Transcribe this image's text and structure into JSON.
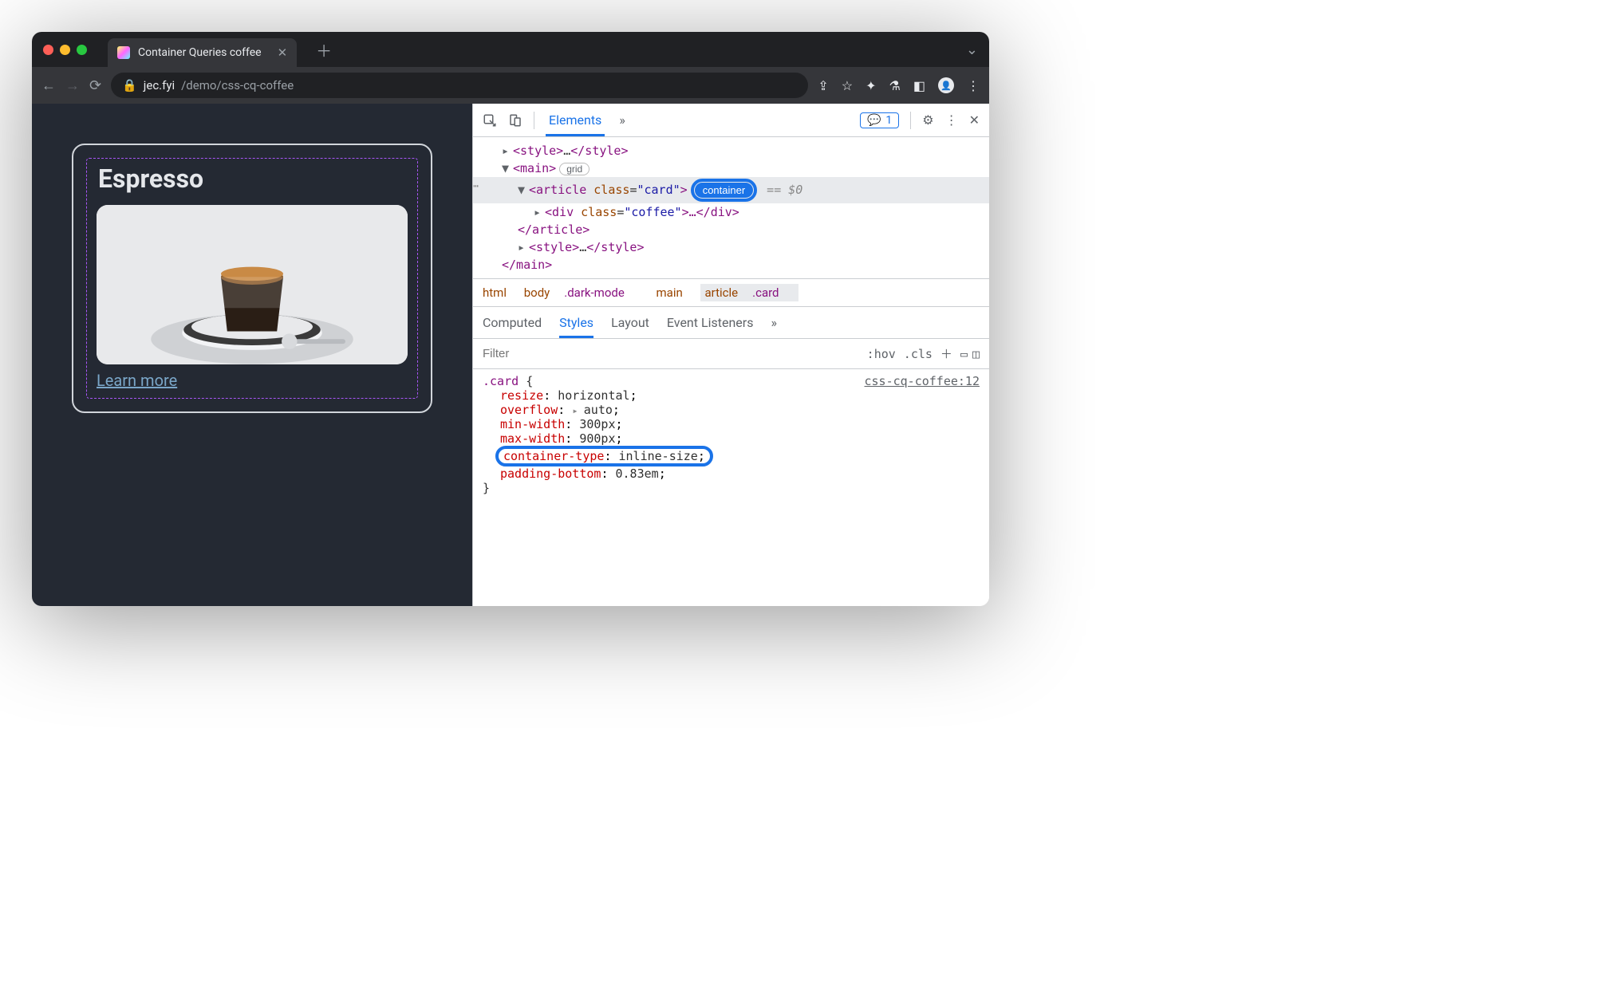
{
  "tab": {
    "title": "Container Queries coffee"
  },
  "url": {
    "host": "jec.fyi",
    "path": "/demo/css-cq-coffee"
  },
  "page": {
    "heading": "Espresso",
    "link": "Learn more"
  },
  "devtools": {
    "topTabs": {
      "elements": "Elements",
      "more": "»",
      "msgCount": "1"
    },
    "dom": {
      "style1a": "<style>",
      "style1b": "…",
      "style1c": "</style>",
      "mainOpen": "<main>",
      "gridBadge": "grid",
      "articleOpen": "<article ",
      "articleClass": "class",
      "eq": "=",
      "articleClassVal": "\"card\"",
      "gt": ">",
      "containerBadge": "container",
      "refvar": "== $0",
      "divOpen": "<div ",
      "divClass": "class",
      "divClassVal": "\"coffee\"",
      "divRest": ">…</div>",
      "articleClose": "</article>",
      "style2a": "<style>",
      "style2b": "…",
      "style2c": "</style>",
      "mainClose": "</main>"
    },
    "crumbs": {
      "html": "html",
      "body": "body",
      "bodyClass": ".dark-mode",
      "main": "main",
      "article": "article",
      "articleClass": ".card"
    },
    "subTabs": {
      "computed": "Computed",
      "styles": "Styles",
      "layout": "Layout",
      "events": "Event Listeners",
      "more": "»"
    },
    "filter": {
      "placeholder": "Filter",
      "hov": ":hov",
      "cls": ".cls"
    },
    "css": {
      "src": "css-cq-coffee:12",
      "selector": ".card",
      "p1": "resize",
      "v1": "horizontal",
      "p2": "overflow",
      "v2": "auto",
      "p3": "min-width",
      "v3": "300px",
      "p4": "max-width",
      "v4": "900px",
      "p5": "container-type",
      "v5": "inline-size",
      "p6": "padding-bottom",
      "v6": "0.83em"
    }
  }
}
